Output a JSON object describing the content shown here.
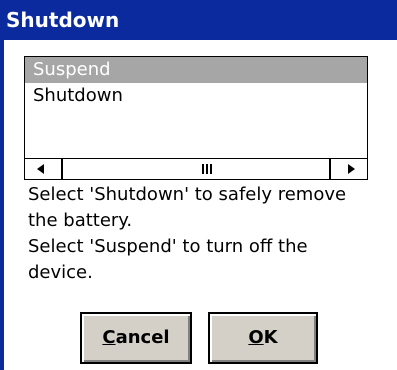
{
  "dialog": {
    "title": "Shutdown",
    "options": [
      {
        "label": "Suspend",
        "selected": true
      },
      {
        "label": "Shutdown",
        "selected": false
      }
    ],
    "message_lines": [
      "Select 'Shutdown' to safely remove",
      "the battery.",
      "Select 'Suspend' to turn off the",
      "device."
    ],
    "buttons": {
      "cancel": {
        "mnemonic": "C",
        "rest": "ancel"
      },
      "ok": {
        "mnemonic": "O",
        "rest": "K"
      }
    }
  },
  "colors": {
    "titlebar": "#0a2a9e",
    "selection": "#a6a6a6",
    "button_face": "#d4d0c8"
  },
  "icons": [
    "scroll-left-arrow-icon",
    "scroll-right-arrow-icon",
    "scroll-thumb-grip-icon"
  ]
}
